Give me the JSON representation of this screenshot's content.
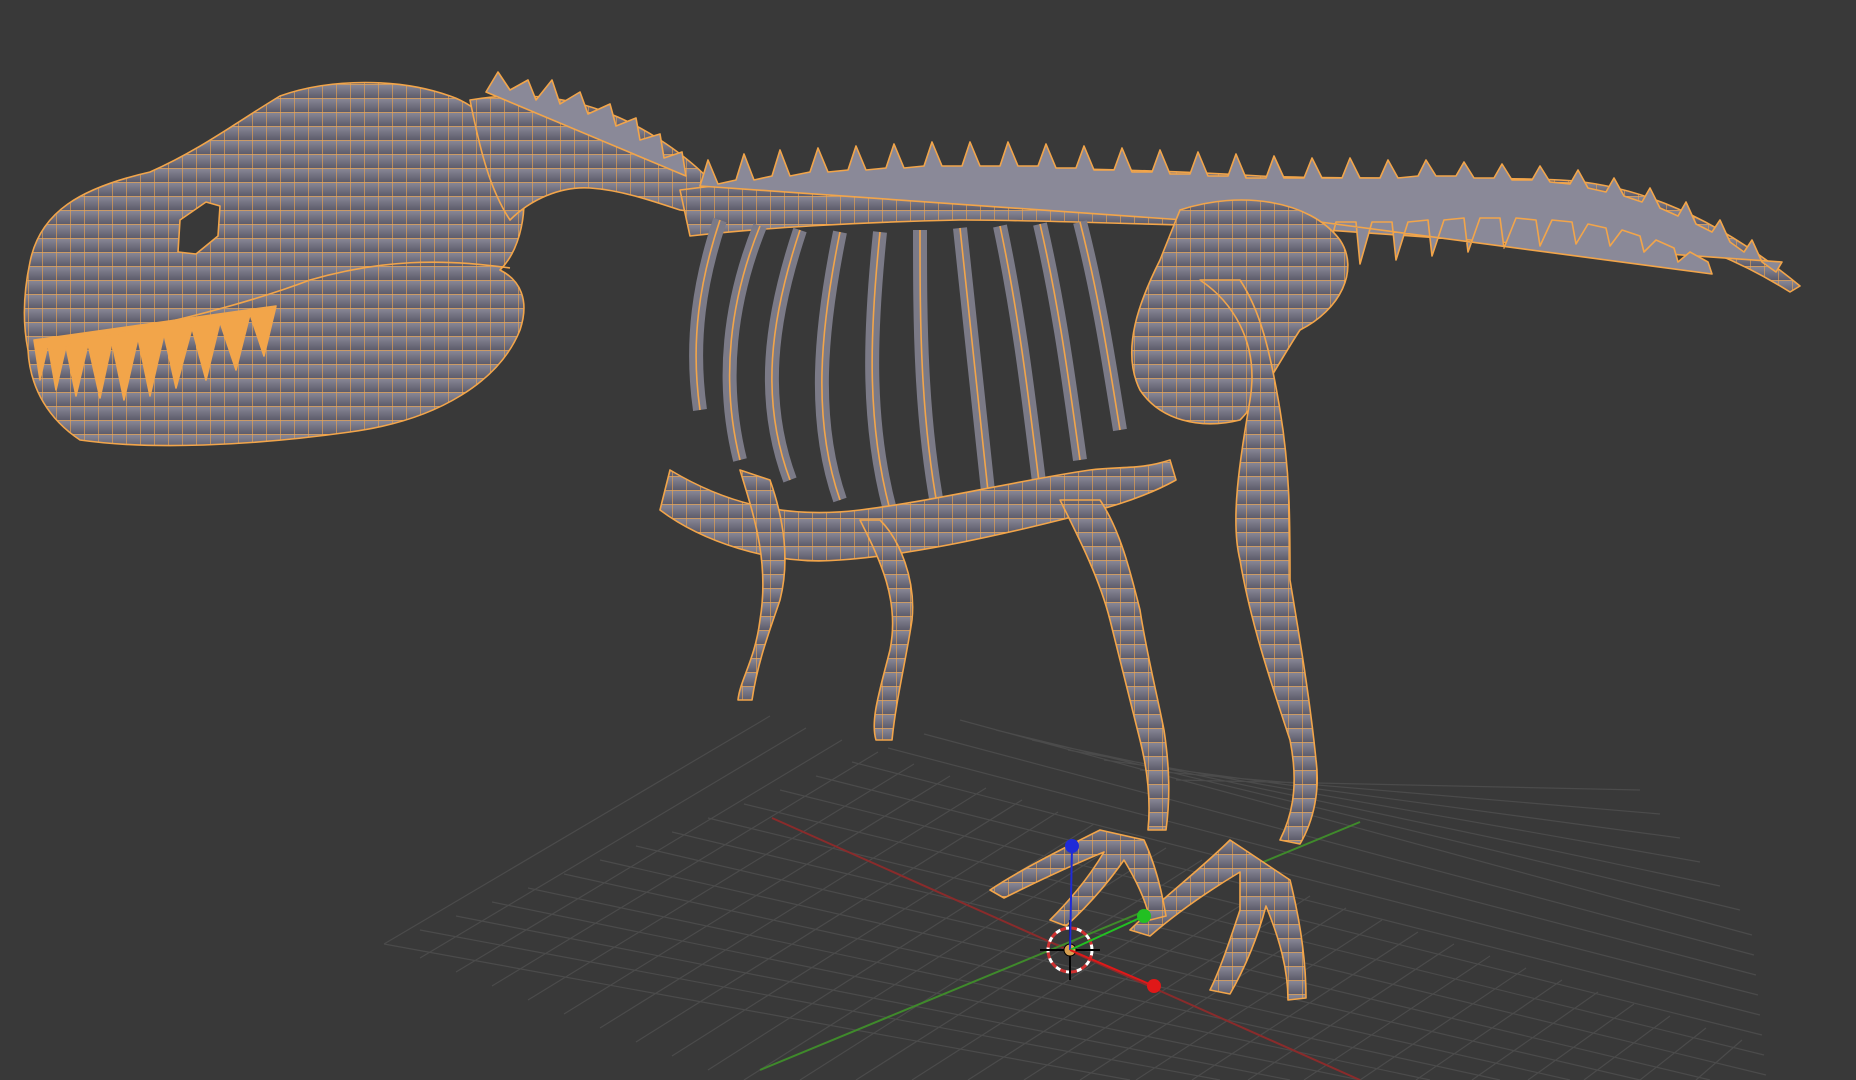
{
  "viewport": {
    "background_color": "#393939",
    "grid_line_color": "#4a4a4a",
    "x_axis_color": "#8a2b2b",
    "y_axis_color": "#3f8a2b",
    "selection_outline_color": "#f2a54a",
    "mesh_fill_color": "#7b7a87",
    "mesh_shadow_color": "#4f4f5c",
    "selected_object": "dinosaur-skeleton-mesh",
    "gizmo": {
      "icon": "transform-manipulator-icon",
      "z_handle_color": "#1f2bd8",
      "y_handle_color": "#22c022",
      "x_handle_color": "#e01818"
    },
    "cursor_icon": "3d-cursor-icon"
  }
}
